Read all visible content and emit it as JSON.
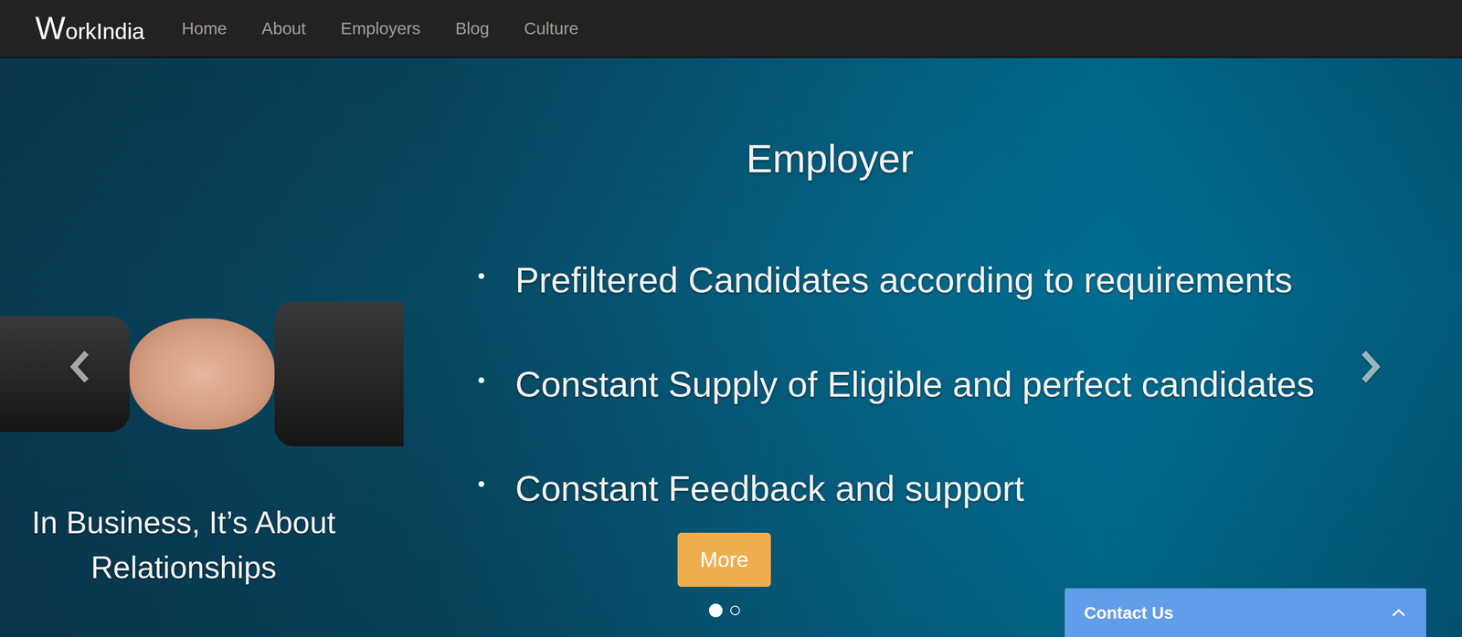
{
  "logo": "WorkIndia",
  "nav": [
    {
      "label": "Home"
    },
    {
      "label": "About"
    },
    {
      "label": "Employers"
    },
    {
      "label": "Blog"
    },
    {
      "label": "Culture"
    }
  ],
  "slide": {
    "caption": "In Business, It’s About Relationships",
    "title": "Employer",
    "bullets": [
      "Prefiltered Candidates according to requirements",
      "Constant Supply of Eligible and perfect candidates",
      "Constant Feedback and support"
    ],
    "button": "More"
  },
  "indicators": [
    {
      "selected": true
    },
    {
      "selected": false
    }
  ],
  "contact": {
    "label": "Contact Us",
    "expanded": false
  }
}
